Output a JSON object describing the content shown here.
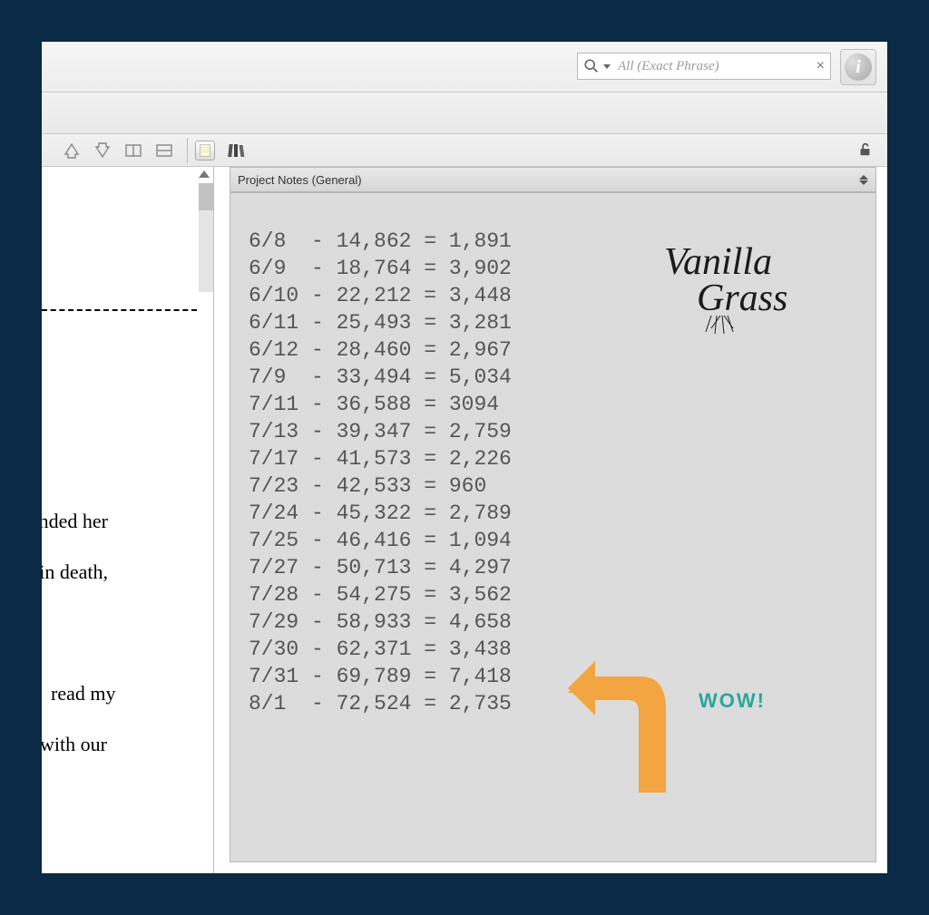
{
  "search": {
    "placeholder": "All (Exact Phrase)",
    "clear": "×"
  },
  "info_button": {
    "glyph": "i"
  },
  "notes_header": {
    "title": "Project Notes (General)"
  },
  "doc_fragments": {
    "line1": "rrounded her",
    "line2": "But in death,",
    "line3": "read my",
    "line4": "with our"
  },
  "notes_lines": [
    "6/8  - 14,862 = 1,891",
    "6/9  - 18,764 = 3,902",
    "6/10 - 22,212 = 3,448",
    "6/11 - 25,493 = 3,281",
    "6/12 - 28,460 = 2,967",
    "7/9  - 33,494 = 5,034",
    "7/11 - 36,588 = 3094",
    "7/13 - 39,347 = 2,759",
    "7/17 - 41,573 = 2,226",
    "7/23 - 42,533 = 960",
    "7/24 - 45,322 = 2,789",
    "7/25 - 46,416 = 1,094",
    "7/27 - 50,713 = 4,297",
    "7/28 - 54,275 = 3,562",
    "7/29 - 58,933 = 4,658",
    "7/30 - 62,371 = 3,438",
    "7/31 - 69,789 = 7,418",
    "8/1  - 72,524 = 2,735"
  ],
  "watermark": {
    "text1": "Vanilla",
    "text2": "Grass"
  },
  "annotation": {
    "wow": "WOW!"
  },
  "toolbar_icons": {
    "up": "up-arrow-icon",
    "down": "down-arrow-icon",
    "split_h": "split-horizontal-icon",
    "split_v": "split-vertical-icon",
    "notepad": "notepad-icon",
    "books": "books-icon",
    "lock": "unlock-icon",
    "search": "search-icon"
  }
}
